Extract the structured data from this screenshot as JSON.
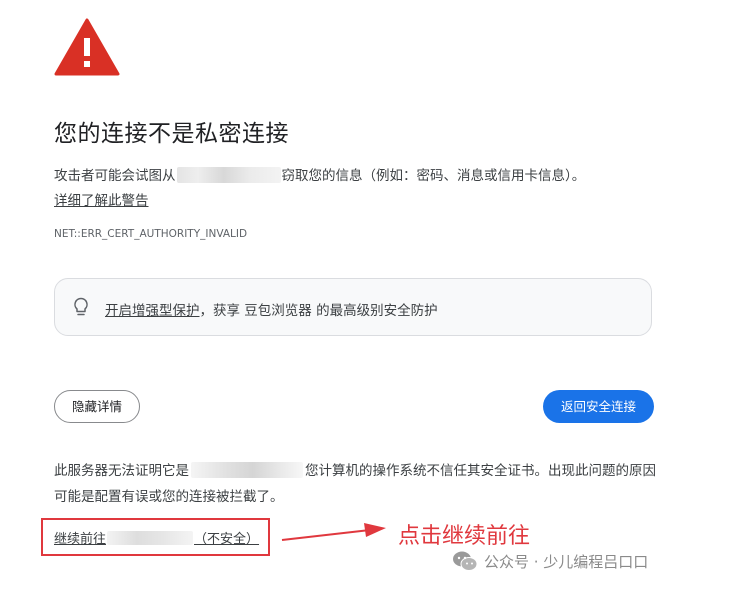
{
  "page": {
    "title": "您的连接不是私密连接",
    "description_prefix": "攻击者可能会试图从",
    "description_suffix": "窃取您的信息（例如：密码、消息或信用卡信息）。",
    "learn_more": "详细了解此警告",
    "error_code": "NET::ERR_CERT_AUTHORITY_INVALID"
  },
  "enhanced_protection": {
    "link_text": "开启增强型保护",
    "rest_text": "，获享 豆包浏览器 的最高级别安全防护"
  },
  "buttons": {
    "hide_details": "隐藏详情",
    "back_to_safety": "返回安全连接"
  },
  "details": {
    "text_prefix": "此服务器无法证明它是",
    "text_suffix": "您计算机的操作系统不信任其安全证书。出现此问题的原因可能是配置有误或您的连接被拦截了。"
  },
  "proceed": {
    "prefix": "继续前往",
    "suffix": "（不安全）"
  },
  "annotation": {
    "text": "点击继续前往"
  },
  "watermark": {
    "text": "公众号 · 少儿编程吕口口"
  },
  "colors": {
    "warning_red": "#d93025",
    "primary_blue": "#1a73e8",
    "annotation_red": "#e0383e"
  }
}
